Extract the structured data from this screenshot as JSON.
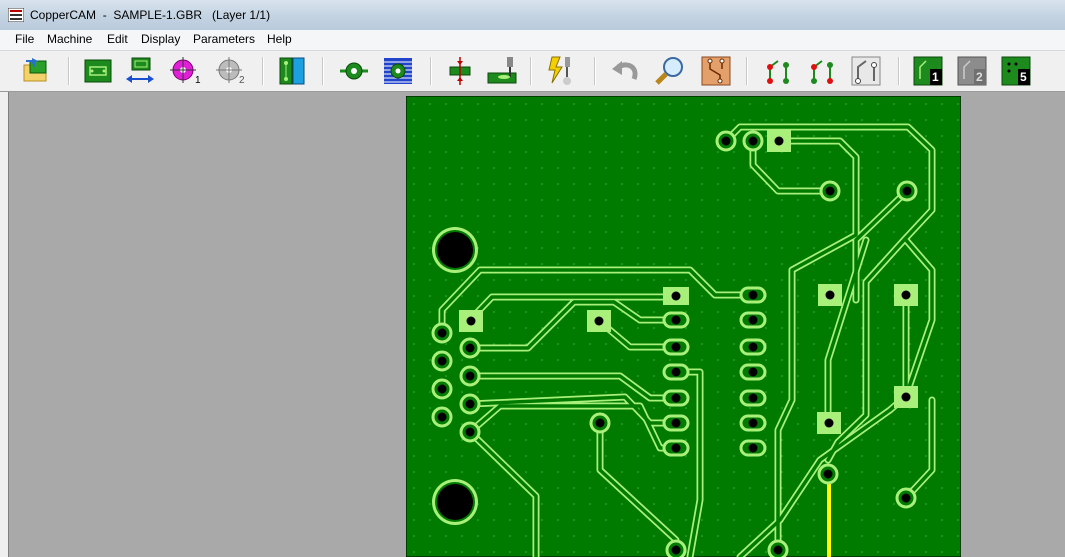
{
  "window": {
    "title": "CopperCAM  -  SAMPLE-1.GBR   (Layer 1/1)"
  },
  "menu": {
    "items": [
      {
        "label": "File"
      },
      {
        "label": "Machine"
      },
      {
        "label": "Edit"
      },
      {
        "label": "Display"
      },
      {
        "label": "Parameters"
      },
      {
        "label": "Help"
      }
    ]
  },
  "toolbar": {
    "layer_buttons": [
      {
        "label": "1"
      },
      {
        "label": "2"
      },
      {
        "label": "5"
      }
    ],
    "reference_point_labels": [
      "1",
      "2"
    ]
  },
  "colors": {
    "board": "#007b00",
    "copper_outline": "#a8f07a",
    "selected_track": "#ffff00",
    "drill_hole": "#000000"
  }
}
